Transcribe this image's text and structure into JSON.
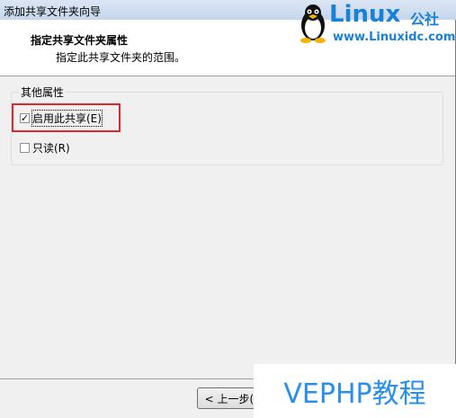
{
  "window": {
    "title": "添加共享文件夹向导"
  },
  "header": {
    "title": "指定共享文件夹属性",
    "description": "指定此共享文件夹的范围。"
  },
  "logo": {
    "word": "Linux",
    "cn": "公社",
    "url": "www.Linuxidc.com"
  },
  "group": {
    "legend": "其他属性",
    "options": [
      {
        "label": "启用此共享(E)",
        "checked": true
      },
      {
        "label": "只读(R)",
        "checked": false
      }
    ]
  },
  "buttons": {
    "back": "< 上一步(B"
  },
  "watermark": "VEPHP教程",
  "colors": {
    "highlight_box": "#e0262b",
    "watermark_text": "#2a8fe8",
    "logo": "#1a82d6"
  }
}
